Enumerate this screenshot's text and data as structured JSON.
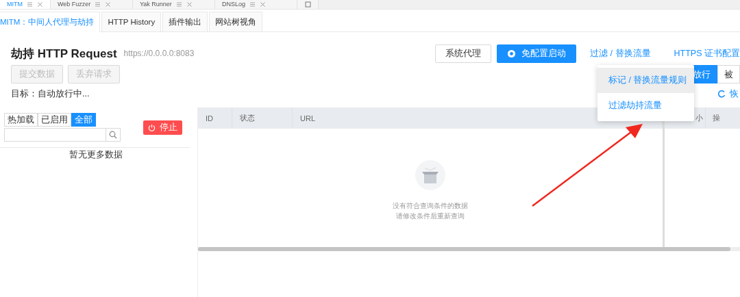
{
  "window_tabs": [
    {
      "label": "MITM",
      "selected": true
    },
    {
      "label": "Web Fuzzer",
      "selected": false
    },
    {
      "label": "Yak Runner",
      "selected": false
    },
    {
      "label": "DNSLog",
      "selected": false
    }
  ],
  "tabs": [
    {
      "label": "MITM：中间人代理与劫持",
      "selected": true
    },
    {
      "label": "HTTP History",
      "selected": false
    },
    {
      "label": "插件输出",
      "selected": false
    },
    {
      "label": "网站树视角",
      "selected": false
    }
  ],
  "header": {
    "title": "劫持 HTTP Request",
    "address": "https://0.0.0.0:8083",
    "actions": [
      {
        "kind": "button",
        "label": "系统代理"
      },
      {
        "kind": "primary",
        "label": "免配置启动"
      },
      {
        "kind": "link",
        "label": "过滤 / 替换流量"
      },
      {
        "kind": "link",
        "label": "HTTPS 证书配置"
      }
    ],
    "request_buttons": [
      {
        "label": "提交数据",
        "disabled": true
      },
      {
        "label": "丢弃请求",
        "disabled": true
      }
    ],
    "mode_buttons": [
      {
        "label": "放行",
        "selected": true
      },
      {
        "label": "被",
        "selected": false
      }
    ],
    "target": "目标：自动放行中...",
    "restore_link": "恢"
  },
  "dropdown": {
    "items": [
      {
        "label": "标记 / 替换流量规则",
        "selected": true
      },
      {
        "label": "过滤劫持流量",
        "selected": false
      }
    ]
  },
  "sidebar": {
    "filters": [
      {
        "label": "热加载",
        "selected": false
      },
      {
        "label": "已启用",
        "selected": false
      },
      {
        "label": "全部",
        "selected": true
      }
    ],
    "stop_button": "停止",
    "empty_text": "暂无更多数据"
  },
  "table": {
    "columns": [
      "ID",
      "状态",
      "URL"
    ],
    "empty_text": [
      "没有符合查询条件的数据",
      "请修改条件后重新查询"
    ]
  },
  "side_table": {
    "columns": [
      "小",
      "操"
    ]
  }
}
